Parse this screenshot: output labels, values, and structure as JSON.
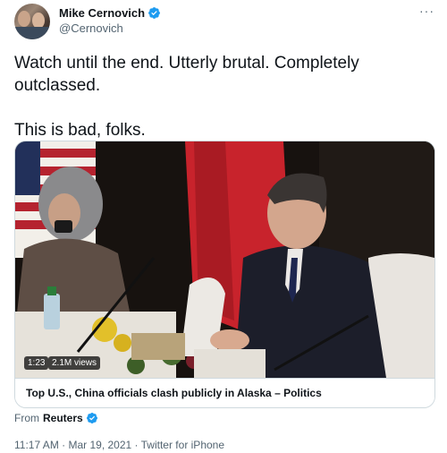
{
  "author": {
    "display_name": "Mike Cernovich",
    "handle": "@Cernovich",
    "verified_icon": "verified-badge-icon"
  },
  "more_menu": "···",
  "tweet_text": {
    "line1": "Watch until the end. Utterly brutal. Completely outclassed.",
    "line2": "This is bad, folks."
  },
  "media": {
    "duration": "1:23",
    "views": "2.1M views"
  },
  "card": {
    "title": "Top U.S., China officials clash publicly in Alaska – Politics"
  },
  "source": {
    "prefix": "From",
    "name": "Reuters"
  },
  "meta": "11:17 AM · Mar 19, 2021 · Twitter for iPhone",
  "colors": {
    "verified_blue": "#1d9bf0",
    "text_primary": "#0f1419",
    "text_secondary": "#536471",
    "border": "#cfd9de"
  }
}
